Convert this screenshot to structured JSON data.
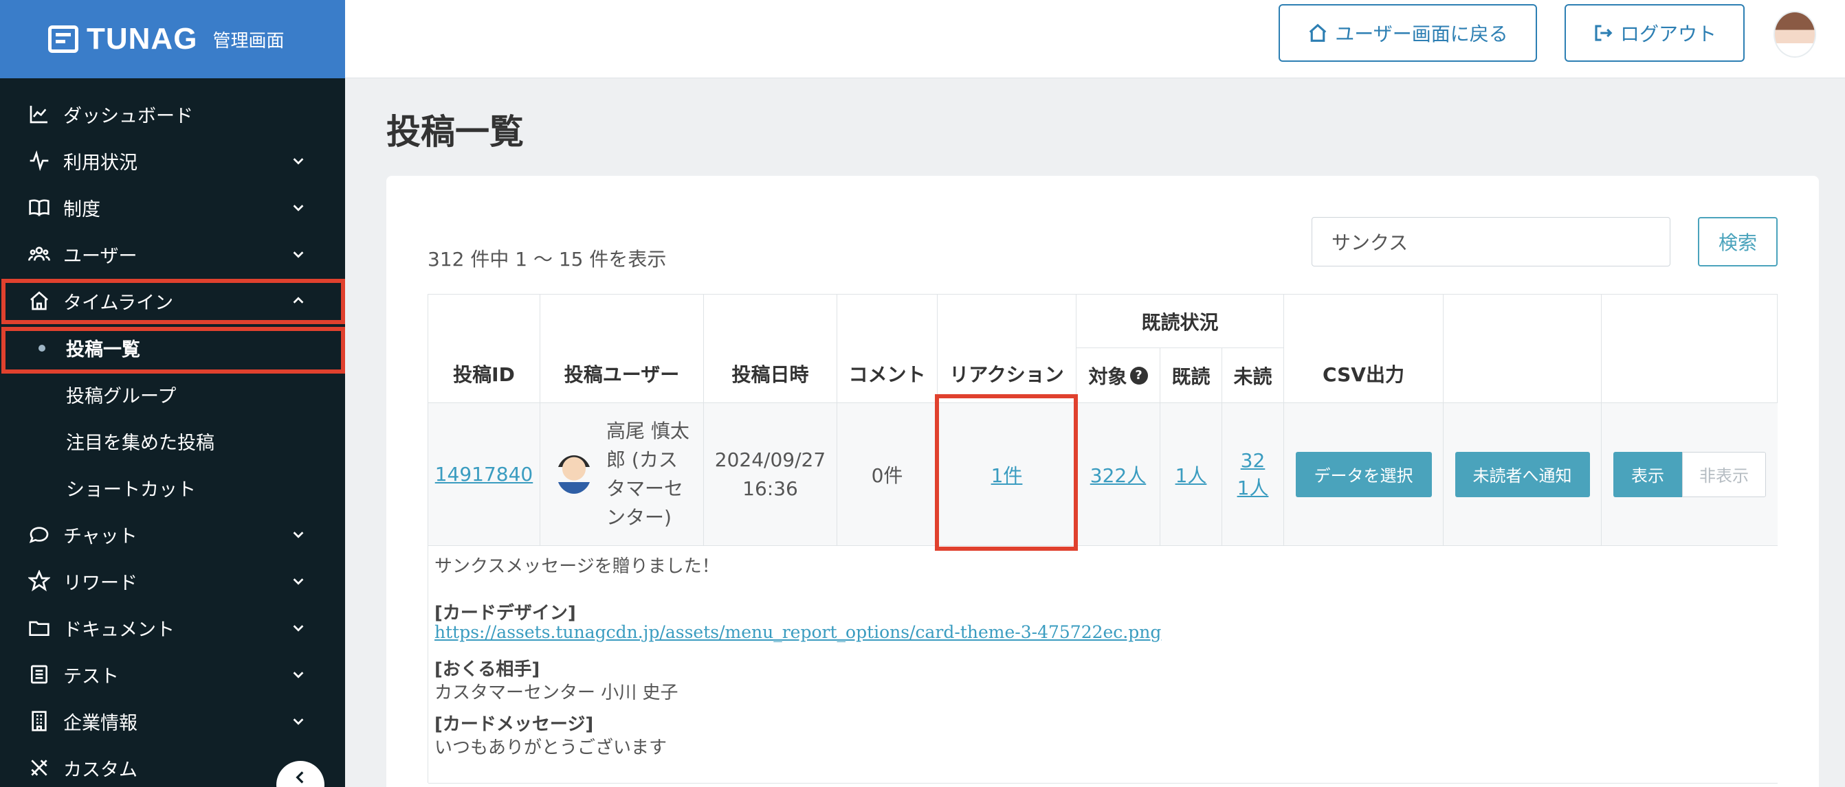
{
  "brand": {
    "name": "TUNAG",
    "subtitle": "管理画面"
  },
  "header": {
    "back_label": "ユーザー画面に戻る",
    "logout_label": "ログアウト"
  },
  "sidebar": {
    "items": [
      {
        "label": "ダッシュボード",
        "icon": "chart-line-icon"
      },
      {
        "label": "利用状況",
        "icon": "pulse-icon"
      },
      {
        "label": "制度",
        "icon": "book-icon"
      },
      {
        "label": "ユーザー",
        "icon": "users-icon"
      },
      {
        "label": "タイムライン",
        "icon": "home-icon"
      },
      {
        "label": "チャット",
        "icon": "chat-bubble-icon"
      },
      {
        "label": "リワード",
        "icon": "star-icon"
      },
      {
        "label": "ドキュメント",
        "icon": "folder-icon"
      },
      {
        "label": "テスト",
        "icon": "checklist-icon"
      },
      {
        "label": "企業情報",
        "icon": "building-icon"
      },
      {
        "label": "カスタム",
        "icon": "tools-icon"
      }
    ],
    "subitems": [
      "投稿一覧",
      "投稿グループ",
      "注目を集めた投稿",
      "ショートカット"
    ]
  },
  "main": {
    "title": "投稿一覧",
    "count_text": "312 件中 1 〜 15 件を表示",
    "search": {
      "value": "サンクス",
      "button_label": "検索"
    },
    "table": {
      "headers": {
        "post_id": "投稿ID",
        "post_user": "投稿ユーザー",
        "post_date": "投稿日時",
        "comment": "コメント",
        "reaction": "リアクション",
        "read_status": "既読状況",
        "target": "対象",
        "read": "既読",
        "unread": "未読",
        "csv": "CSV出力"
      },
      "row": {
        "post_id": "14917840",
        "user_name": "高尾 慎太郎 (カスタマーセンター)",
        "date": "2024/09/27",
        "time": "16:36",
        "comment": "0件",
        "reaction": "1件",
        "target": "322人",
        "read": "1人",
        "unread": "321人",
        "select_data_label": "データを選択",
        "notify_label": "未読者へ通知",
        "show_label": "表示",
        "hide_label": "非表示"
      },
      "post_body": {
        "intro": "サンクスメッセージを贈りました！",
        "card_design_label": "[カードデザイン]",
        "card_design_url": "https://assets.tunagcdn.jp/assets/menu_report_options/card-theme-3-475722ec.png",
        "recipient_label": "[おくる相手]",
        "recipient": "カスタマーセンター 小川 史子",
        "message_label": "[カードメッセージ]",
        "message": "いつもありがとうございます"
      }
    }
  },
  "colors": {
    "highlight": "#e0412e",
    "accent": "#4aa3bc",
    "sidebar_bg": "#0f1f26",
    "brand_bg": "#3a7dc9"
  }
}
